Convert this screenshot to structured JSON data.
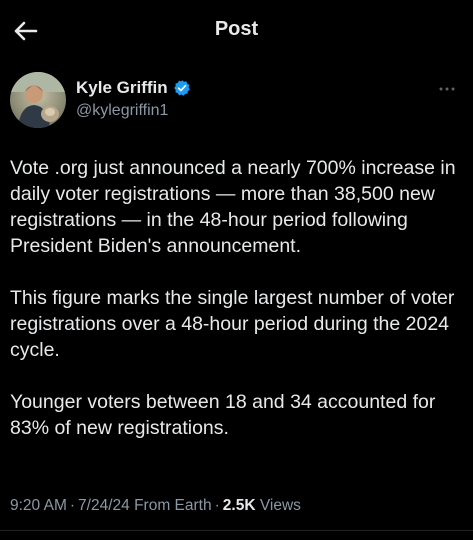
{
  "header": {
    "title": "Post",
    "back_icon": "arrow-left-icon"
  },
  "author": {
    "name": "Kyle Griffin",
    "handle": "@kylegriffin1",
    "verified_icon": "verified-badge-icon",
    "verified_color": "#1d9bf0",
    "more_icon": "more-dots-icon"
  },
  "tweet": {
    "paragraphs": [
      "Vote .org just announced a nearly 700% increase in daily voter registrations — more than 38,500 new registrations — in the 48-hour period following President Biden's announcement.",
      "This figure marks the single largest number of voter registrations over a 48-hour period during the 2024 cycle.",
      "Younger voters between 18 and 34 accounted for 83% of new registrations."
    ]
  },
  "meta": {
    "time": "9:20 AM",
    "date": "7/24/24",
    "source": "From Earth",
    "views_count": "2.5K",
    "views_label": "Views"
  },
  "colors": {
    "background": "#000000",
    "text_primary": "#e7e9ea",
    "text_secondary": "#8b98a5"
  }
}
